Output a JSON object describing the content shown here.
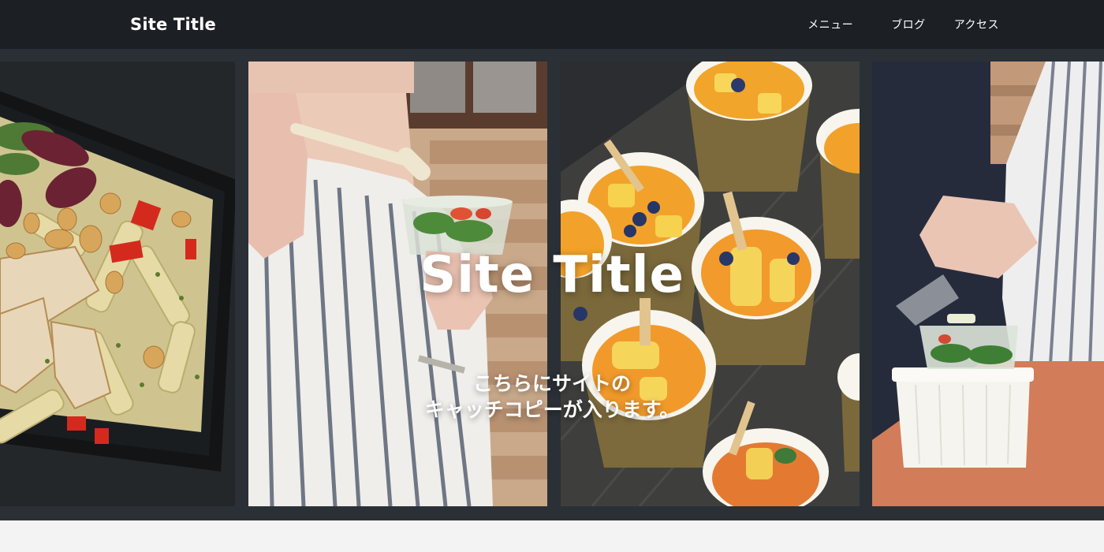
{
  "header": {
    "site_title": "Site Title",
    "nav": [
      {
        "label": "メニュー"
      },
      {
        "label": "ブログ"
      },
      {
        "label": "アクセス"
      }
    ]
  },
  "hero": {
    "title": "Site Title",
    "catch_line1": "こちらにサイトの",
    "catch_line2": "キャッチコピーが入ります。",
    "photos": [
      {
        "subject": "pasta-salad-box"
      },
      {
        "subject": "person-eating-salad"
      },
      {
        "subject": "fruit-cups-on-board"
      },
      {
        "subject": "person-holding-salad-cup"
      }
    ]
  },
  "colors": {
    "header_bg": "#1c1f24",
    "hero_bg": "#2a3036",
    "text": "#ffffff",
    "footer_strip": "#f3f3f3"
  }
}
